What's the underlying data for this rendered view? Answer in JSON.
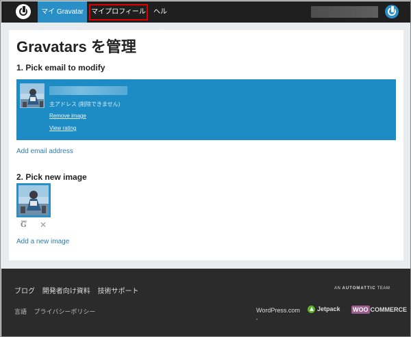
{
  "nav": {
    "tab_my_gravatar": "マイ Gravatar",
    "tab_my_profile": "マイプロフィール",
    "tab_help": "ヘルプ"
  },
  "main": {
    "title": "Gravatars を管理",
    "step1_heading": "1. Pick email to modify",
    "email": {
      "primary_note": "主アドレス (削除できません)",
      "remove_image": "Remove image",
      "view_rating": "View rating"
    },
    "add_email": "Add email address",
    "step2_heading": "2. Pick new image",
    "image_actions": {
      "gravatar_glyph": "G",
      "remove_glyph": "✕"
    },
    "add_image": "Add a new image"
  },
  "footer": {
    "links_row1": [
      "ブログ",
      "開発者向け資料",
      "技術サポート"
    ],
    "links_row2": [
      "言語",
      "プライバシーポリシー"
    ],
    "automattic_prefix": "AN",
    "automattic_name": "AUTOMATTIC",
    "automattic_suffix": "TEAM",
    "wordpress": "WordPress.com",
    "jetpack": "Jetpack",
    "woo_badge": "WOO",
    "woo_rest": "COMMERCE"
  },
  "colors": {
    "accent": "#2a8fc6",
    "highlight_border": "#e00000",
    "topbar": "#1f1f1f",
    "footer": "#2b2b2b"
  }
}
